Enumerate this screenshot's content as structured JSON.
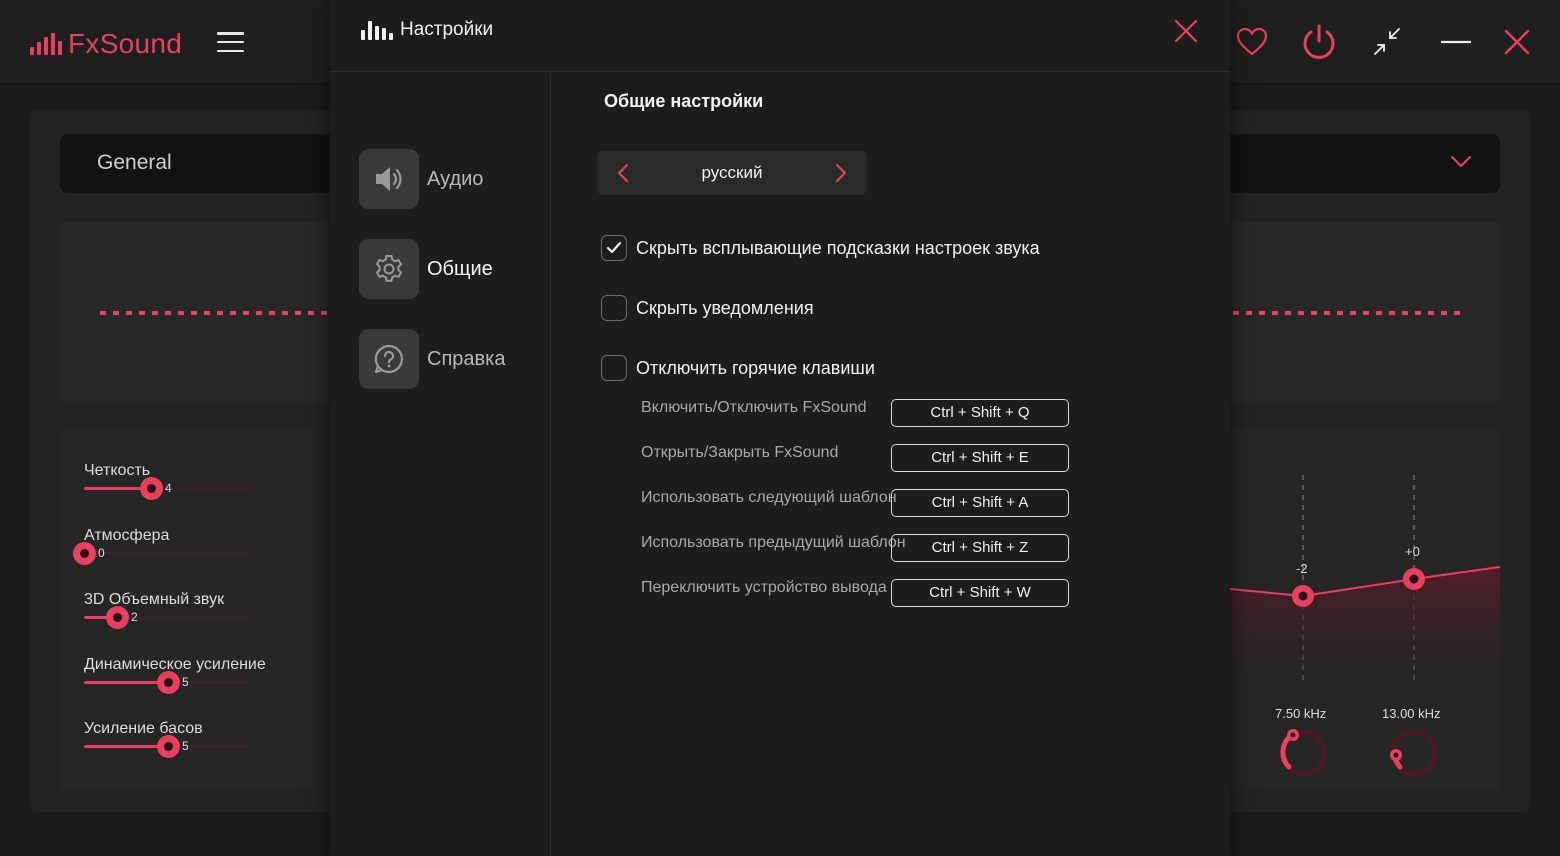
{
  "app": {
    "name": "FxSound"
  },
  "titlebar": {
    "icons": [
      "menu-icon",
      "heart-icon",
      "power-icon",
      "minimize-window-icon",
      "minimize-icon",
      "close-icon"
    ]
  },
  "main": {
    "preset": "General",
    "effects": [
      {
        "label": "Четкость",
        "value": "4",
        "level": 0.4
      },
      {
        "label": "Атмосфера",
        "value": "0",
        "level": 0.0
      },
      {
        "label": "3D Объемный звук",
        "value": "2",
        "level": 0.2
      },
      {
        "label": "Динамическое усиление",
        "value": "5",
        "level": 0.5
      },
      {
        "label": "Усиление басов",
        "value": "5",
        "level": 0.5
      }
    ],
    "eq": {
      "bands": [
        {
          "freq": "7.50 kHz",
          "gain": "-2"
        },
        {
          "freq": "13.00 kHz",
          "gain": "+0"
        }
      ]
    }
  },
  "settings": {
    "title": "Настройки",
    "nav": [
      {
        "label": "Аудио",
        "icon": "speaker-icon"
      },
      {
        "label": "Общие",
        "icon": "gear-icon",
        "active": true
      },
      {
        "label": "Справка",
        "icon": "help-icon"
      }
    ],
    "section_title": "Общие настройки",
    "language": "русский",
    "options": [
      {
        "label": "Скрыть всплывающие подсказки настроек звука",
        "checked": true
      },
      {
        "label": "Скрыть уведомления",
        "checked": false
      },
      {
        "label": "Отключить горячие клавиши",
        "checked": false
      }
    ],
    "hotkeys": [
      {
        "label": "Включить/Отключить FxSound",
        "keys": "Ctrl +  Shift + Q"
      },
      {
        "label": "Открыть/Закрыть FxSound",
        "keys": "Ctrl +  Shift + E"
      },
      {
        "label": "Использовать следующий шаблон",
        "keys": "Ctrl +  Shift + A"
      },
      {
        "label": "Использовать предыдущий шаблон",
        "keys": "Ctrl +  Shift + Z"
      },
      {
        "label": "Переключить устройство вывода",
        "keys": "Ctrl +  Shift + W"
      }
    ]
  },
  "colors": {
    "accent": "#e8405e",
    "background": "#1b1b1b",
    "modal": "#1d1d1d"
  }
}
